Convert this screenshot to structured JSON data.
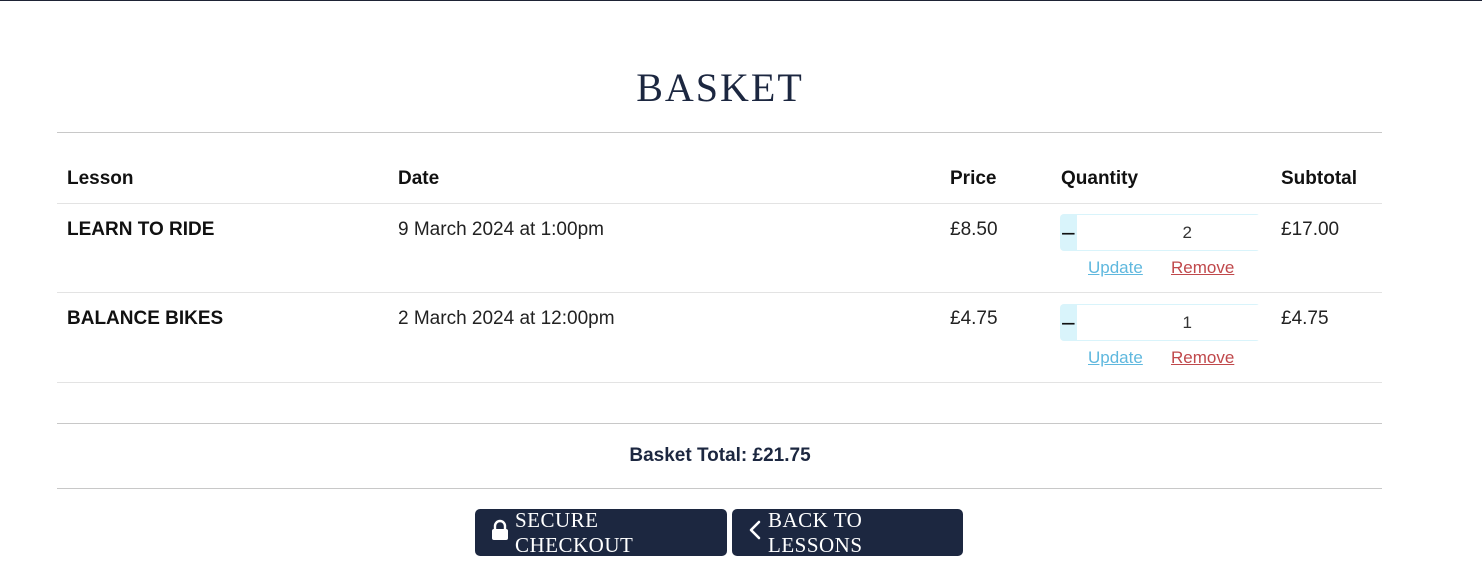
{
  "page": {
    "title": "BASKET"
  },
  "table": {
    "headers": {
      "lesson": "Lesson",
      "date": "Date",
      "price": "Price",
      "quantity": "Quantity",
      "subtotal": "Subtotal"
    },
    "rows": [
      {
        "lesson": "LEARN TO RIDE",
        "date": "9 March 2024 at 1:00pm",
        "price": "£8.50",
        "quantity": "2",
        "subtotal": "£17.00",
        "update_label": "Update",
        "remove_label": "Remove"
      },
      {
        "lesson": "BALANCE BIKES",
        "date": "2 March 2024 at 12:00pm",
        "price": "£4.75",
        "quantity": "1",
        "subtotal": "£4.75",
        "update_label": "Update",
        "remove_label": "Remove"
      }
    ],
    "minus_symbol": "−",
    "plus_symbol": "+"
  },
  "summary": {
    "total": "Basket Total: £21.75"
  },
  "actions": {
    "checkout_label": "SECURE CHECKOUT",
    "checkout_icon": "lock-icon",
    "back_label": "BACK TO LESSONS",
    "back_icon": "chevron-left-icon"
  },
  "colors": {
    "navy": "#1c2740",
    "qty_bg": "#d9f4fb",
    "update": "#5fb8de",
    "remove": "#c0484b"
  }
}
